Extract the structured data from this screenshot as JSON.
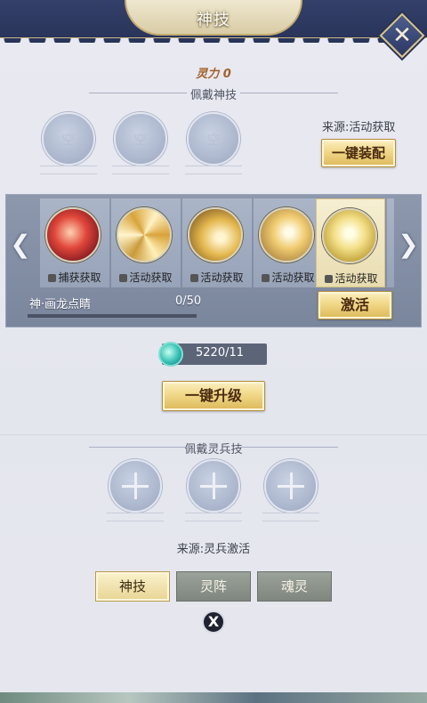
{
  "header": {
    "title": "神技",
    "close_icon": "close-icon"
  },
  "power_label": "灵力 0",
  "equip_section": {
    "title": "佩戴神技",
    "slots": [
      "空",
      "空",
      "空"
    ],
    "source": "来源:活动获取",
    "equip_all_label": "一键装配"
  },
  "carousel": {
    "cards": [
      {
        "label": "捕获获取",
        "icon": "red-flame-skill-icon",
        "selected": false
      },
      {
        "label": "活动获取",
        "icon": "golden-swirl-skill-icon",
        "selected": false
      },
      {
        "label": "活动获取",
        "icon": "golden-wave-skill-icon",
        "selected": false
      },
      {
        "label": "活动获取",
        "icon": "golden-burst-skill-icon",
        "selected": false
      },
      {
        "label": "活动获取",
        "icon": "golden-figure-skill-icon",
        "selected": true
      }
    ],
    "skill_name": "神·画龙点睛",
    "progress_text": "0/50",
    "progress": 0,
    "activate_label": "激活"
  },
  "currency": {
    "icon": "jade-coin-icon",
    "amount": "5220/11"
  },
  "upgrade_all_label": "一键升级",
  "spirit_section": {
    "title": "佩戴灵兵技",
    "source": "来源:灵兵激活"
  },
  "tabs": [
    {
      "label": "神技",
      "active": true
    },
    {
      "label": "灵阵",
      "active": false
    },
    {
      "label": "魂灵",
      "active": false
    }
  ],
  "bottom_close": "X"
}
